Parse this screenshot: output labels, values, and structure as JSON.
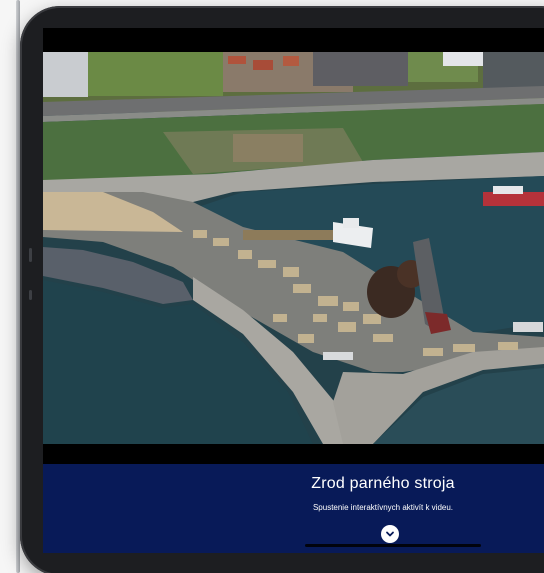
{
  "video": {
    "description_visible": false
  },
  "panel": {
    "title": "Zrod parného stroja",
    "subtitle": "Spustenie interaktívnych aktivít k videu.",
    "expand_icon": "chevron-down-icon",
    "background_color": "#081a58",
    "text_color": "#ffffff"
  }
}
